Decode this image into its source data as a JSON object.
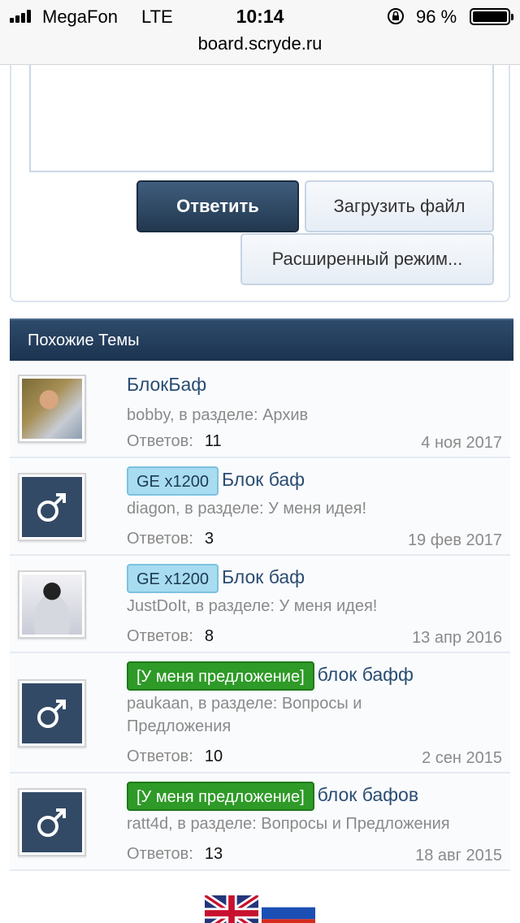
{
  "status_bar": {
    "carrier": "MegaFon",
    "network": "LTE",
    "time": "10:14",
    "battery": "96 %",
    "icons": [
      "signal-icon",
      "rotation-lock-icon",
      "battery-icon"
    ]
  },
  "browser": {
    "url": "board.scryde.ru"
  },
  "reply": {
    "reply_button": "Ответить",
    "upload_button": "Загрузить файл",
    "advanced_button": "Расширенный режим..."
  },
  "similar": {
    "header": "Похожие Темы",
    "replies_label": "Ответов:",
    "threads": [
      {
        "title": "БлокБаф",
        "prefix": "",
        "meta": "bobby, в разделе: Архив",
        "replies": "11",
        "date": "4 ноя 2017",
        "avatar": "user-photo"
      },
      {
        "title": "Блок баф",
        "prefix": "GE x1200",
        "meta": "diagon, в разделе: У меня идея!",
        "replies": "3",
        "date": "19 фев 2017",
        "avatar": "male-default-icon"
      },
      {
        "title": "Блок баф",
        "prefix": "GE x1200",
        "meta": "JustDoIt, в разделе: У меня идея!",
        "replies": "8",
        "date": "13 апр 2016",
        "avatar": "user-photo"
      },
      {
        "title": "блок бафф",
        "prefix": "[У меня предложение]",
        "meta_line1": "paukaan, в разделе: Вопросы и",
        "meta_line2": "Предложения",
        "replies": "10",
        "date": "2 сен 2015",
        "avatar": "male-default-icon"
      },
      {
        "title": "блок бафов",
        "prefix": "[У меня предложение]",
        "meta": "ratt4d, в разделе: Вопросы и Предложения",
        "replies": "13",
        "date": "18 авг 2015",
        "avatar": "male-default-icon"
      }
    ]
  },
  "languages": [
    "english-flag-icon",
    "russian-flag-icon"
  ],
  "colors": {
    "header_bg": "#1b3350",
    "link": "#2a4d72",
    "prefix_blue": "#a8dcf0",
    "prefix_green": "#2e9a27"
  }
}
